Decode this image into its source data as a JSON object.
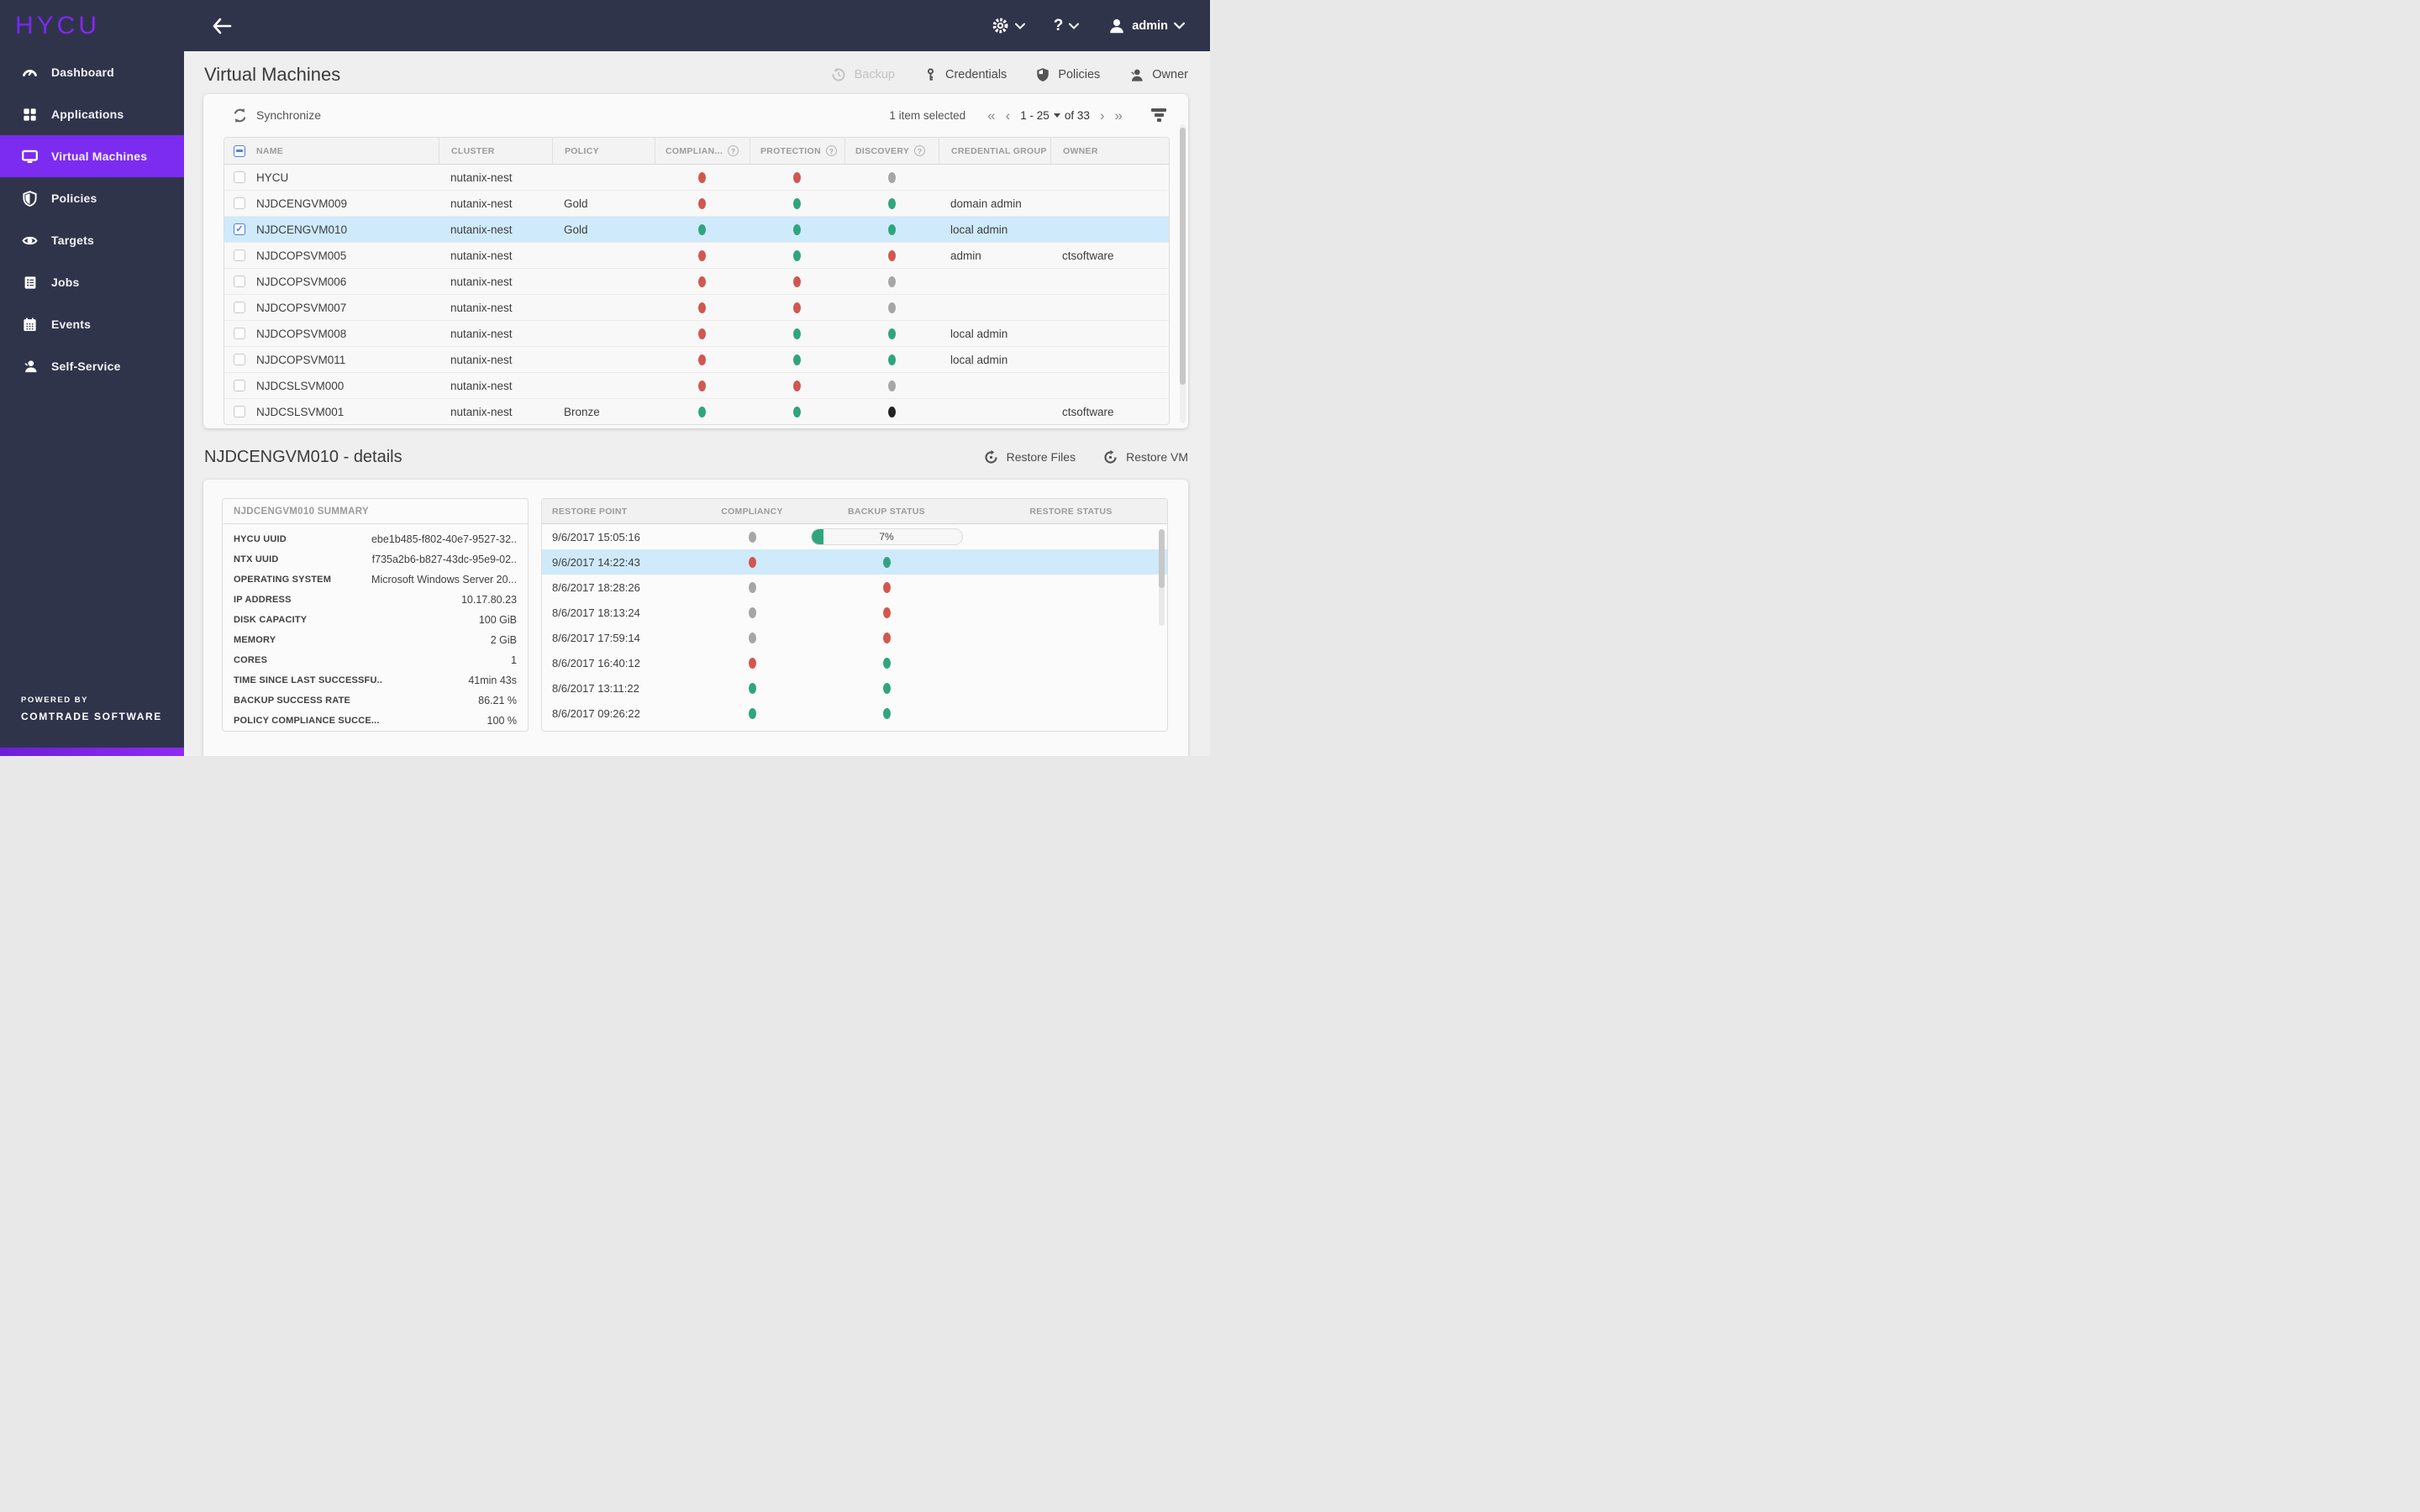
{
  "topbar": {
    "logo": "HYCU",
    "user": "admin"
  },
  "sidebar": {
    "items": [
      {
        "label": "Dashboard"
      },
      {
        "label": "Applications"
      },
      {
        "label": "Virtual Machines",
        "active": true
      },
      {
        "label": "Policies"
      },
      {
        "label": "Targets"
      },
      {
        "label": "Jobs"
      },
      {
        "label": "Events"
      },
      {
        "label": "Self-Service"
      }
    ],
    "powered_by_line1": "POWERED BY",
    "powered_by_line2": "COMTRADE SOFTWARE"
  },
  "page": {
    "title": "Virtual Machines"
  },
  "toolbar": {
    "backup": "Backup",
    "credentials": "Credentials",
    "policies": "Policies",
    "owner": "Owner"
  },
  "vm_table": {
    "synchronize": "Synchronize",
    "selection_text": "1 item selected",
    "page_range": "1 - 25",
    "page_of": "of 33",
    "pagination_icons": {
      "first": "«",
      "prev": "‹",
      "next": "›",
      "last": "»"
    },
    "columns": [
      "NAME",
      "CLUSTER",
      "POLICY",
      "COMPLIAN...",
      "PROTECTION",
      "DISCOVERY",
      "CREDENTIAL GROUP",
      "OWNER"
    ],
    "rows": [
      {
        "name": "HYCU",
        "cluster": "nutanix-nest",
        "policy": "",
        "compliancy": "red",
        "protection": "red",
        "discovery": "gray",
        "credential_group": "",
        "owner": ""
      },
      {
        "name": "NJDCENGVM009",
        "cluster": "nutanix-nest",
        "policy": "Gold",
        "compliancy": "red",
        "protection": "green",
        "discovery": "green",
        "credential_group": "domain admin",
        "owner": ""
      },
      {
        "name": "NJDCENGVM010",
        "cluster": "nutanix-nest",
        "policy": "Gold",
        "compliancy": "green",
        "protection": "green",
        "discovery": "green",
        "credential_group": "local admin",
        "owner": "",
        "checked": true,
        "selected": true
      },
      {
        "name": "NJDCOPSVM005",
        "cluster": "nutanix-nest",
        "policy": "",
        "compliancy": "red",
        "protection": "green",
        "discovery": "red",
        "credential_group": "admin",
        "owner": "ctsoftware"
      },
      {
        "name": "NJDCOPSVM006",
        "cluster": "nutanix-nest",
        "policy": "",
        "compliancy": "red",
        "protection": "red",
        "discovery": "gray",
        "credential_group": "",
        "owner": ""
      },
      {
        "name": "NJDCOPSVM007",
        "cluster": "nutanix-nest",
        "policy": "",
        "compliancy": "red",
        "protection": "red",
        "discovery": "gray",
        "credential_group": "",
        "owner": ""
      },
      {
        "name": "NJDCOPSVM008",
        "cluster": "nutanix-nest",
        "policy": "",
        "compliancy": "red",
        "protection": "green",
        "discovery": "green",
        "credential_group": "local admin",
        "owner": ""
      },
      {
        "name": "NJDCOPSVM011",
        "cluster": "nutanix-nest",
        "policy": "",
        "compliancy": "red",
        "protection": "green",
        "discovery": "green",
        "credential_group": "local admin",
        "owner": ""
      },
      {
        "name": "NJDCSLSVM000",
        "cluster": "nutanix-nest",
        "policy": "",
        "compliancy": "red",
        "protection": "red",
        "discovery": "gray",
        "credential_group": "",
        "owner": ""
      },
      {
        "name": "NJDCSLSVM001",
        "cluster": "nutanix-nest",
        "policy": "Bronze",
        "compliancy": "green",
        "protection": "green",
        "discovery": "black",
        "credential_group": "",
        "owner": "ctsoftware"
      }
    ]
  },
  "details": {
    "title": "NJDCENGVM010 - details",
    "restore_files": "Restore Files",
    "restore_vm": "Restore VM"
  },
  "summary": {
    "title": "NJDCENGVM010 SUMMARY",
    "rows": [
      {
        "label": "HYCU UUID",
        "value": "ebe1b485-f802-40e7-9527-32.."
      },
      {
        "label": "NTX UUID",
        "value": "f735a2b6-b827-43dc-95e9-02.."
      },
      {
        "label": "OPERATING SYSTEM",
        "value": "Microsoft Windows Server 20..."
      },
      {
        "label": "IP ADDRESS",
        "value": "10.17.80.23"
      },
      {
        "label": "DISK CAPACITY",
        "value": "100 GiB"
      },
      {
        "label": "MEMORY",
        "value": "2 GiB"
      },
      {
        "label": "CORES",
        "value": "1"
      },
      {
        "label": "TIME SINCE LAST SUCCESSFU..",
        "value": "41min 43s"
      },
      {
        "label": "BACKUP SUCCESS RATE",
        "value": "86.21 %"
      },
      {
        "label": "POLICY COMPLIANCE SUCCE...",
        "value": "100 %"
      }
    ]
  },
  "restore_table": {
    "columns": [
      "RESTORE POINT",
      "COMPLIANCY",
      "BACKUP STATUS",
      "RESTORE STATUS"
    ],
    "rows": [
      {
        "time": "9/6/2017 15:05:16",
        "compliancy": "gray",
        "backup": "progress",
        "progress_label": "7%"
      },
      {
        "time": "9/6/2017 14:22:43",
        "compliancy": "red",
        "backup": "green",
        "selected": true
      },
      {
        "time": "8/6/2017 18:28:26",
        "compliancy": "gray",
        "backup": "red"
      },
      {
        "time": "8/6/2017 18:13:24",
        "compliancy": "gray",
        "backup": "red"
      },
      {
        "time": "8/6/2017 17:59:14",
        "compliancy": "gray",
        "backup": "red"
      },
      {
        "time": "8/6/2017 16:40:12",
        "compliancy": "red",
        "backup": "green"
      },
      {
        "time": "8/6/2017 13:11:22",
        "compliancy": "green",
        "backup": "green"
      },
      {
        "time": "8/6/2017 09:26:22",
        "compliancy": "green",
        "backup": "green"
      }
    ]
  },
  "status_colors": {
    "red": "#d15750",
    "green": "#2fa57e",
    "gray": "#a6a6a6",
    "black": "#222222"
  },
  "accent": {
    "purple": "#7b2cf0",
    "selection_blue": "#cfeafb",
    "checkbox_blue": "#4a7df0",
    "navy": "#30344b"
  }
}
